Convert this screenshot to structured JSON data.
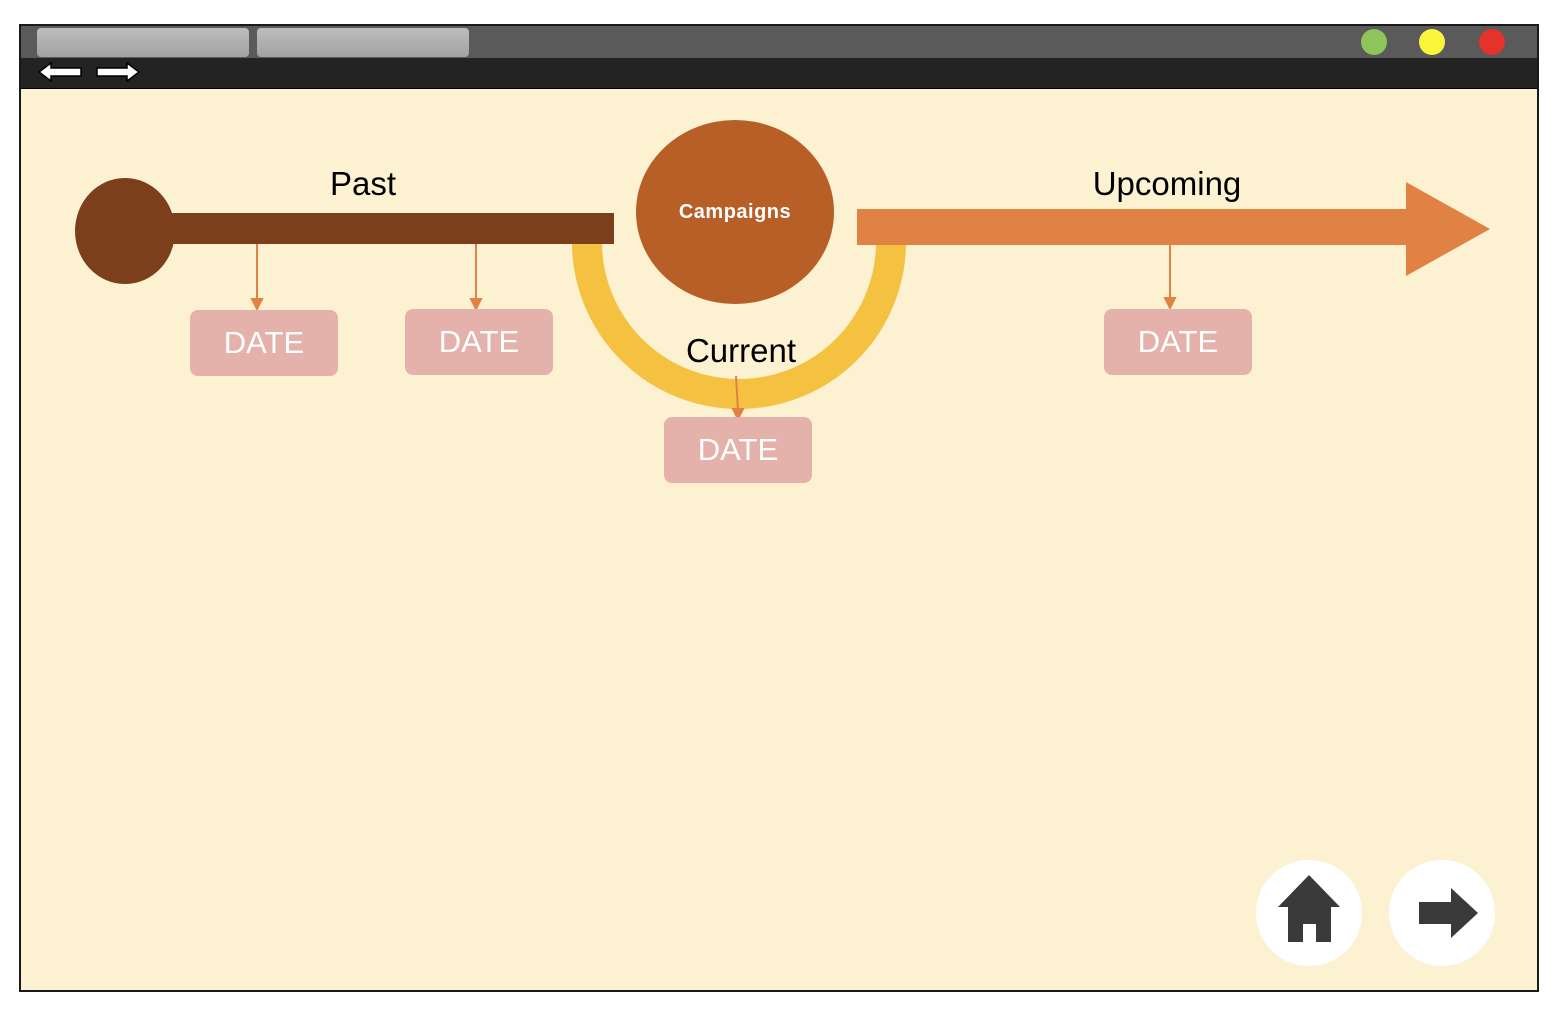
{
  "colors": {
    "page_background": "#fcf1d0",
    "past_bar": "#7b3f1c",
    "upcoming_arrow": "#e08244",
    "current_arc": "#f4c141",
    "campaigns_circle": "#b85f28",
    "date_box": "#e5b1ab",
    "window_green": "#8dc558",
    "window_yellow": "#fbf53a",
    "window_red": "#e5322a"
  },
  "browser": {
    "tabs": [
      "",
      ""
    ],
    "nav_icons": [
      "back-arrow-icon",
      "forward-arrow-icon"
    ],
    "window_buttons": [
      "green",
      "yellow",
      "red"
    ]
  },
  "timeline": {
    "center_label": "Campaigns",
    "past": {
      "label": "Past",
      "dates": [
        "DATE",
        "DATE"
      ]
    },
    "current": {
      "label": "Current",
      "dates": [
        "DATE"
      ]
    },
    "upcoming": {
      "label": "Upcoming",
      "dates": [
        "DATE"
      ]
    }
  },
  "footer_buttons": [
    {
      "icon": "home-icon"
    },
    {
      "icon": "next-arrow-icon"
    }
  ]
}
